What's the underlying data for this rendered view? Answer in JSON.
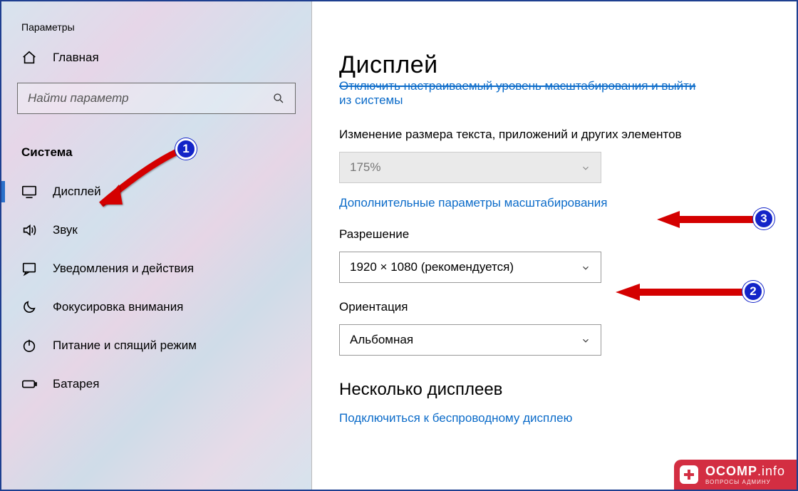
{
  "app_title": "Параметры",
  "home_label": "Главная",
  "search": {
    "placeholder": "Найти параметр"
  },
  "section": "Система",
  "nav": [
    {
      "icon": "monitor",
      "label": "Дисплей",
      "active": true
    },
    {
      "icon": "speaker",
      "label": "Звук",
      "active": false
    },
    {
      "icon": "message",
      "label": "Уведомления и действия",
      "active": false
    },
    {
      "icon": "moon",
      "label": "Фокусировка внимания",
      "active": false
    },
    {
      "icon": "power",
      "label": "Питание и спящий режим",
      "active": false
    },
    {
      "icon": "battery",
      "label": "Батарея",
      "active": false
    }
  ],
  "main": {
    "title": "Дисплей",
    "signout_link_line1": "Отключить настраиваемый уровень масштабирования и выйти",
    "signout_link_line2": "из системы",
    "scale_label": "Изменение размера текста, приложений и других элементов",
    "scale_value": "175%",
    "advanced_scale_link": "Дополнительные параметры масштабирования",
    "resolution_label": "Разрешение",
    "resolution_value": "1920 × 1080 (рекомендуется)",
    "orientation_label": "Ориентация",
    "orientation_value": "Альбомная",
    "multi_heading": "Несколько дисплеев",
    "wireless_link": "Подключиться к беспроводному дисплею"
  },
  "annotations": {
    "m1": "1",
    "m2": "2",
    "m3": "3"
  },
  "watermark": {
    "top": "OCOMP",
    "ext": ".info",
    "bot": "ВОПРОСЫ АДМИНУ"
  }
}
